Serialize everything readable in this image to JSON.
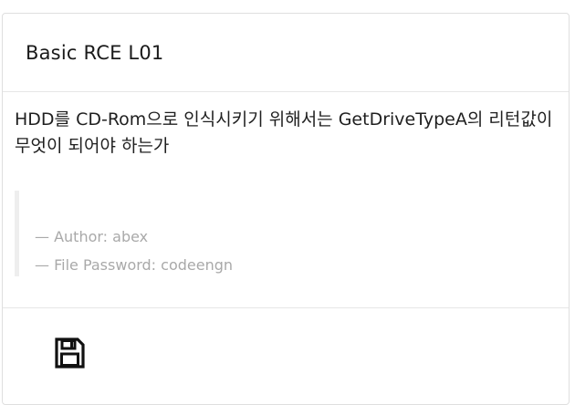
{
  "card": {
    "title": "Basic RCE L01",
    "question": "HDD를 CD-Rom으로 인식시키기 위해서는 GetDriveTypeA의 리턴값이 무엇이 되어야 하는가",
    "author_line": "— Author: abex",
    "password_line": "— File Password: codeengn"
  },
  "icons": {
    "download": "floppy-disk-icon"
  }
}
